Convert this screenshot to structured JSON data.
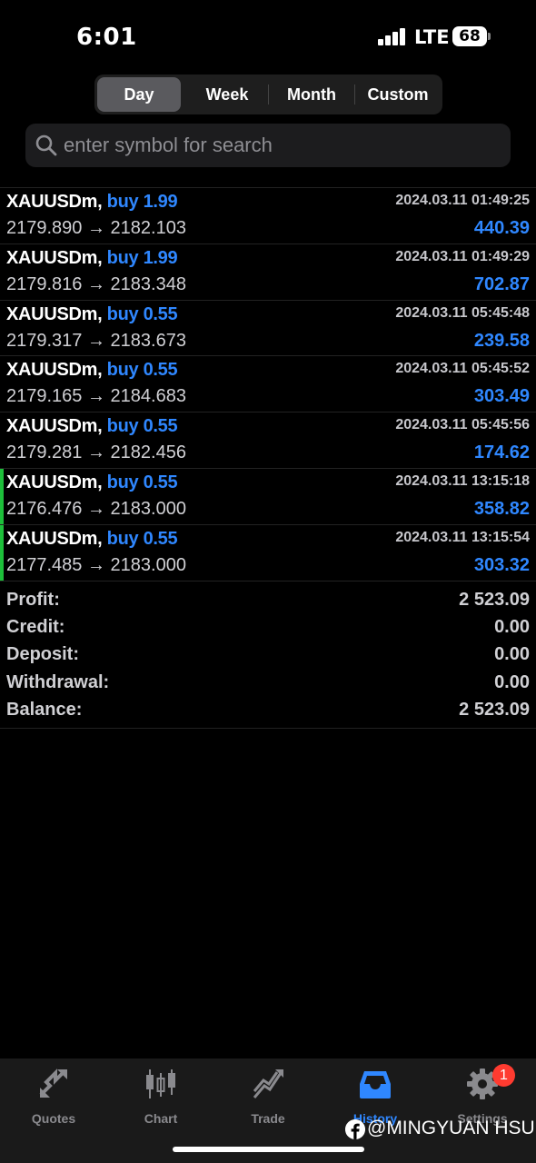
{
  "status": {
    "time": "6:01",
    "network": "LTE",
    "battery": "68"
  },
  "period_tabs": [
    {
      "label": "Day",
      "active": true
    },
    {
      "label": "Week",
      "active": false
    },
    {
      "label": "Month",
      "active": false
    },
    {
      "label": "Custom",
      "active": false
    }
  ],
  "search": {
    "placeholder": "enter symbol for search",
    "value": ""
  },
  "deals": [
    {
      "symbol": "XAUUSDm,",
      "type": "buy 1.99",
      "time": "2024.03.11 01:49:25",
      "prices": "2179.890 → 2182.103",
      "profit": "440.39",
      "marked": false
    },
    {
      "symbol": "XAUUSDm,",
      "type": "buy 1.99",
      "time": "2024.03.11 01:49:29",
      "prices": "2179.816 → 2183.348",
      "profit": "702.87",
      "marked": false
    },
    {
      "symbol": "XAUUSDm,",
      "type": "buy 0.55",
      "time": "2024.03.11 05:45:48",
      "prices": "2179.317 → 2183.673",
      "profit": "239.58",
      "marked": false
    },
    {
      "symbol": "XAUUSDm,",
      "type": "buy 0.55",
      "time": "2024.03.11 05:45:52",
      "prices": "2179.165 → 2184.683",
      "profit": "303.49",
      "marked": false
    },
    {
      "symbol": "XAUUSDm,",
      "type": "buy 0.55",
      "time": "2024.03.11 05:45:56",
      "prices": "2179.281 → 2182.456",
      "profit": "174.62",
      "marked": false
    },
    {
      "symbol": "XAUUSDm,",
      "type": "buy 0.55",
      "time": "2024.03.11 13:15:18",
      "prices": "2176.476 → 2183.000",
      "profit": "358.82",
      "marked": true
    },
    {
      "symbol": "XAUUSDm,",
      "type": "buy 0.55",
      "time": "2024.03.11 13:15:54",
      "prices": "2177.485 → 2183.000",
      "profit": "303.32",
      "marked": true
    }
  ],
  "summary": [
    {
      "label": "Profit:",
      "value": "2 523.09"
    },
    {
      "label": "Credit:",
      "value": "0.00"
    },
    {
      "label": "Deposit:",
      "value": "0.00"
    },
    {
      "label": "Withdrawal:",
      "value": "0.00"
    },
    {
      "label": "Balance:",
      "value": "2 523.09"
    }
  ],
  "tabbar": [
    {
      "label": "Quotes",
      "icon": "quotes-icon",
      "active": false
    },
    {
      "label": "Chart",
      "icon": "chart-icon",
      "active": false
    },
    {
      "label": "Trade",
      "icon": "trade-icon",
      "active": false
    },
    {
      "label": "History",
      "icon": "history-icon",
      "active": true
    },
    {
      "label": "Settings",
      "icon": "settings-icon",
      "active": false
    }
  ],
  "settings_badge": "1",
  "watermark": "@MINGYUAN HSU",
  "colors": {
    "accent": "#2f87ff",
    "marker": "#1dbf3a",
    "badge": "#ff3b30"
  }
}
